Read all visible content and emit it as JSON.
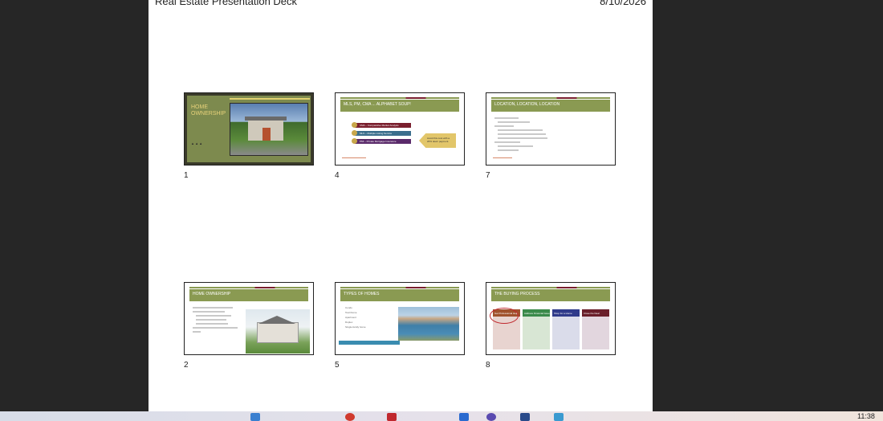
{
  "document": {
    "title": "Real Estate Presentation Deck",
    "date": "8/10/2026"
  },
  "slides": [
    {
      "number": "1",
      "title": "HOME OWNERSHIP"
    },
    {
      "number": "4",
      "title": "MLS, PM, CMA ... ALPHABET SOUP!",
      "items": [
        "CMA – Comparative Market Analysis",
        "MLS – Multiple Listing Service",
        "PMI – Private Mortgage Insurance"
      ],
      "callout": "Avoid this cost with a 20% down payment."
    },
    {
      "number": "7",
      "title": "LOCATION, LOCATION, LOCATION"
    },
    {
      "number": "2",
      "title": "HOME OWNERSHIP"
    },
    {
      "number": "5",
      "title": "TYPES OF HOMES",
      "items": [
        "Condo",
        "Townhome",
        "Apartment",
        "Duplex",
        "Single-family home"
      ]
    },
    {
      "number": "8",
      "title": "THE BUYING PROCESS",
      "steps": [
        "Get Professional Help",
        "Address Financial Issues",
        "Shop for a Home",
        "Close the Deal"
      ]
    }
  ],
  "taskbar": {
    "clock": "11:38"
  }
}
